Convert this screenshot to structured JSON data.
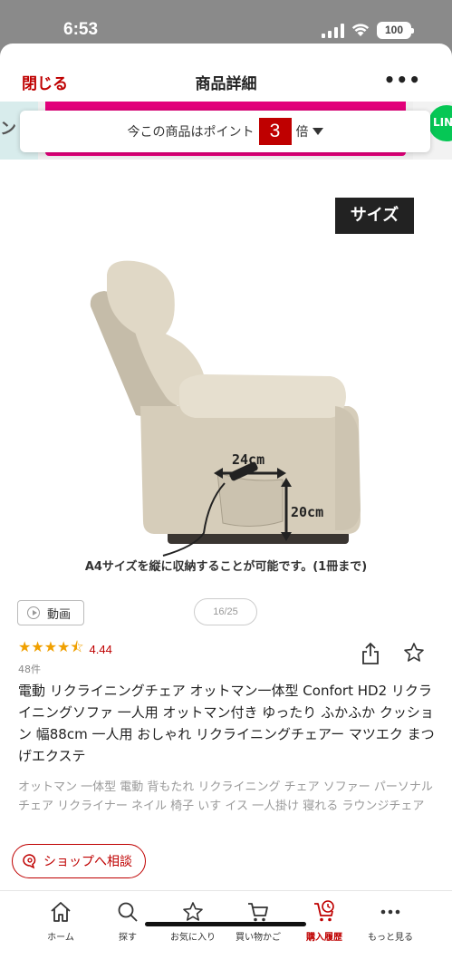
{
  "status_bar": {
    "time": "6:53",
    "battery": "100"
  },
  "header": {
    "close_label": "閉じる",
    "title": "商品詳細",
    "more_label": "•••"
  },
  "banner": {
    "left_text": "ント",
    "right_badge": "LIN"
  },
  "points": {
    "prefix": "今この商品はポイント",
    "multiplier": "3",
    "suffix": "倍"
  },
  "image": {
    "size_tag": "サイズ",
    "width_label": "24cm",
    "height_label": "20cm",
    "caption": "A4サイズを縦に収納することが可能です。(1冊まで)",
    "counter": "16/25"
  },
  "video_button": {
    "label": "動画"
  },
  "rating": {
    "stars": "★★★★⯪",
    "value": "4.44",
    "count": "48件",
    "score": 4.44
  },
  "product": {
    "title": "電動 リクライニングチェア オットマン一体型 Confort HD2 リクライニングソファ 一人用 オットマン付き ゆったり ふかふか クッション 幅88cm 一人用 おしゃれ リクライニングチェアー マツエク まつげエクステ",
    "tags": "オットマン 一体型 電動 背もたれ リクライニング チェア ソファー パーソナルチェア リクライナー ネイル 椅子 いす イス 一人掛け 寝れる ラウンジチェア"
  },
  "shop_chat": {
    "label": "ショップへ相談"
  },
  "nav": {
    "items": [
      {
        "label": "ホーム",
        "icon": "home-icon"
      },
      {
        "label": "探す",
        "icon": "search-icon"
      },
      {
        "label": "お気に入り",
        "icon": "star-icon"
      },
      {
        "label": "買い物かご",
        "icon": "cart-icon"
      },
      {
        "label": "購入履歴",
        "icon": "history-icon"
      },
      {
        "label": "もっと見る",
        "icon": "more-icon"
      }
    ],
    "active_index": 4
  },
  "colors": {
    "brand_red": "#bf0000",
    "star_yellow": "#f0a000",
    "banner_pink": "#e2007a",
    "line_green": "#06c755"
  }
}
